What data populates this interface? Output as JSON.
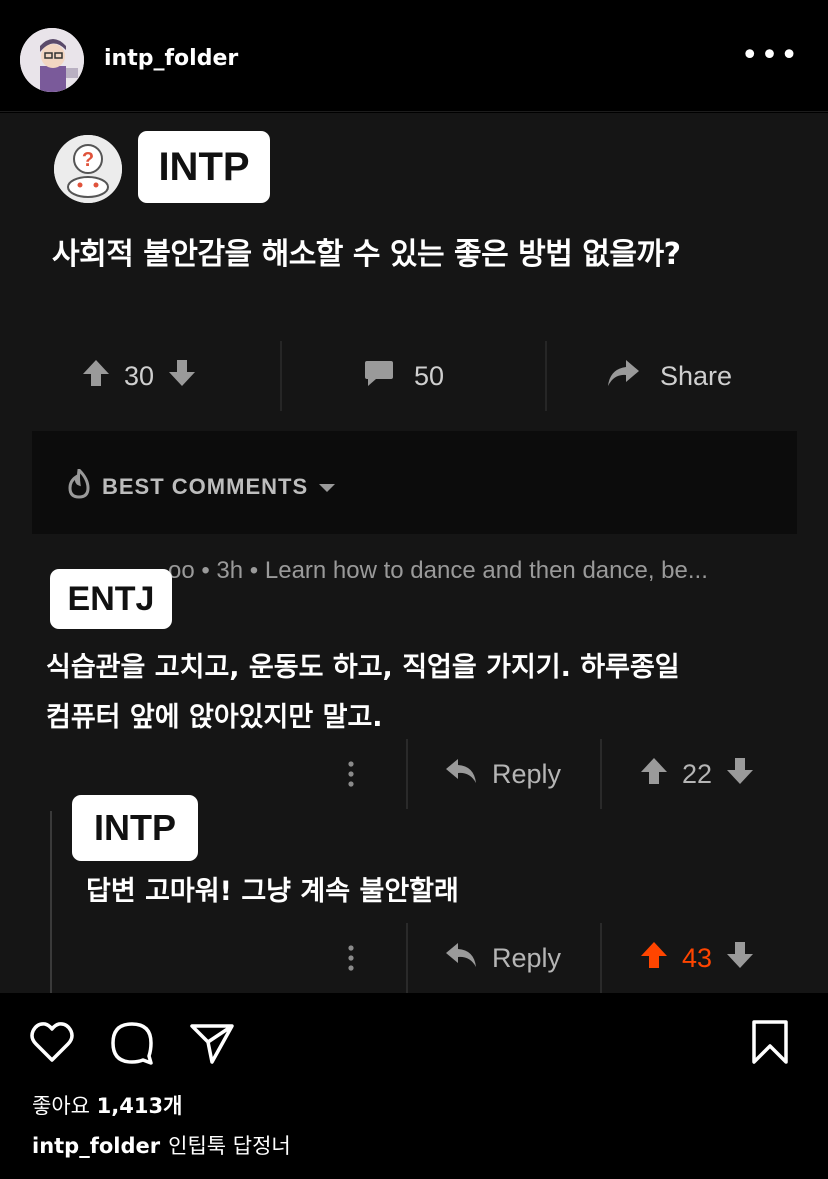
{
  "account": {
    "username": "intp_folder",
    "more_label": "•••"
  },
  "post": {
    "question_badge": "INTP",
    "question": "사회적 불안감을 해소할 수 있는 좋은 방법 없을까?",
    "actions": {
      "score": "30",
      "comments": "50",
      "share": "Share"
    },
    "best_comments_label": "BEST COMMENTS",
    "meta_line": "oo • 3h • Learn how to dance and then dance, be...",
    "comment1": {
      "badge": "ENTJ",
      "line1": "식습관을 고치고, 운동도 하고, 직업을 가지기. 하루종일",
      "line2": "컴퓨터 앞에 앉아있지만 말고.",
      "reply_label": "Reply",
      "score": "22"
    },
    "comment2": {
      "badge": "INTP",
      "text": "답변 고마워! 그냥 계속 불안할래",
      "reply_label": "Reply",
      "score": "43"
    }
  },
  "footer": {
    "likes_label": "좋아요",
    "likes_count": "1,413개",
    "caption_user": "intp_folder",
    "caption_text": "인팁툭 답정너"
  },
  "colors": {
    "upvote_active": "#ff4500",
    "background": "#000000"
  }
}
